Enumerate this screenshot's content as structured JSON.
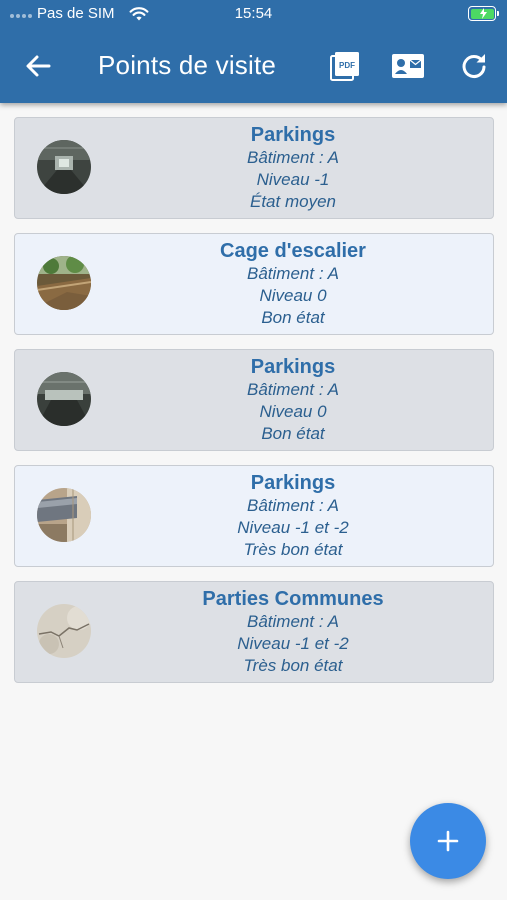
{
  "status_bar": {
    "carrier": "Pas de SIM",
    "time": "15:54",
    "battery_color": "#4cd964"
  },
  "header": {
    "title": "Points de visite",
    "pdf_glyph": "PDF",
    "background": "#2f6ea9",
    "icons": [
      "arrow-left-icon",
      "pdf-file-icon",
      "contact-card-icon",
      "refresh-icon"
    ]
  },
  "visits": [
    {
      "title": "Parkings",
      "building": "Bâtiment : A",
      "level": "Niveau -1",
      "state": "État moyen",
      "thumbnail": "parking-photo"
    },
    {
      "title": "Cage d'escalier",
      "building": "Bâtiment : A",
      "level": "Niveau 0",
      "state": "Bon état",
      "thumbnail": "stairwell-photo"
    },
    {
      "title": "Parkings",
      "building": "Bâtiment : A",
      "level": "Niveau 0",
      "state": "Bon état",
      "thumbnail": "parking-photo"
    },
    {
      "title": "Parkings",
      "building": "Bâtiment : A",
      "level": "Niveau -1 et -2",
      "state": "Très bon état",
      "thumbnail": "pipe-photo"
    },
    {
      "title": "Parties Communes",
      "building": "Bâtiment : A",
      "level": "Niveau -1 et -2",
      "state": "Très bon état",
      "thumbnail": "cracked-wall-photo"
    }
  ],
  "fab": {
    "icon": "plus-icon",
    "color": "#3b8ae5"
  }
}
